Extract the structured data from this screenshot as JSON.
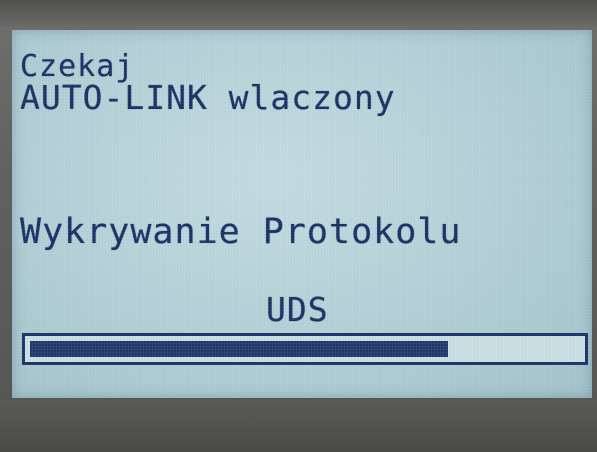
{
  "display": {
    "status_line_1": "Czekaj",
    "status_line_2": "AUTO-LINK wlaczony",
    "status_line_3": "Wykrywanie Protokolu",
    "protocol": "UDS"
  },
  "progress": {
    "fraction": 0.76
  },
  "colors": {
    "lcd_background": "#b7d2d9",
    "lcd_text": "#1c3366",
    "progress_fill": "#22386b",
    "bezel": "#5f5f5d"
  }
}
